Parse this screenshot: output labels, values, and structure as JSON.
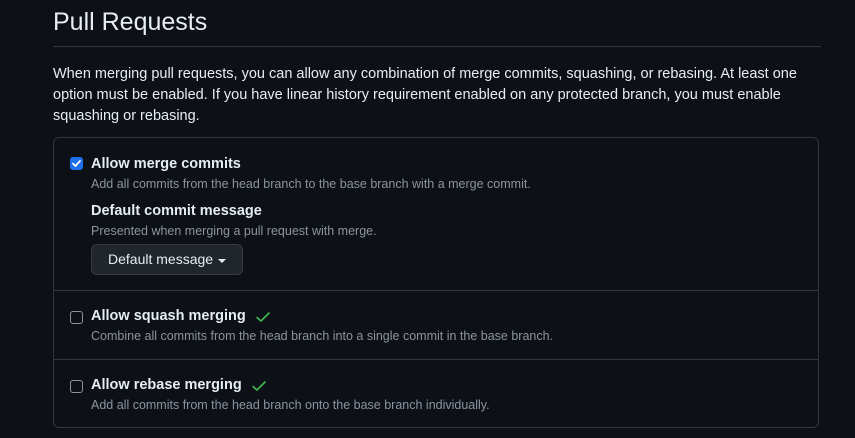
{
  "header": {
    "title": "Pull Requests"
  },
  "description": "When merging pull requests, you can allow any combination of merge commits, squashing, or rebasing. At least one option must be enabled. If you have linear history requirement enabled on any protected branch, you must enable squashing or rebasing.",
  "options": [
    {
      "label": "Allow merge commits",
      "description": "Add all commits from the head branch to the base branch with a merge commit.",
      "checked": true,
      "default_commit_message": {
        "label": "Default commit message",
        "description": "Presented when merging a pull request with merge.",
        "selected": "Default message"
      }
    },
    {
      "label": "Allow squash merging",
      "description": "Combine all commits from the head branch into a single commit in the base branch.",
      "checked": false,
      "status_icon": "check-icon"
    },
    {
      "label": "Allow rebase merging",
      "description": "Add all commits from the head branch onto the base branch individually.",
      "checked": false,
      "status_icon": "check-icon"
    }
  ],
  "colors": {
    "background": "#0d1117",
    "accent": "#1f6feb",
    "success": "#3fb950",
    "muted_text": "#8b949e",
    "border": "#30363d"
  }
}
